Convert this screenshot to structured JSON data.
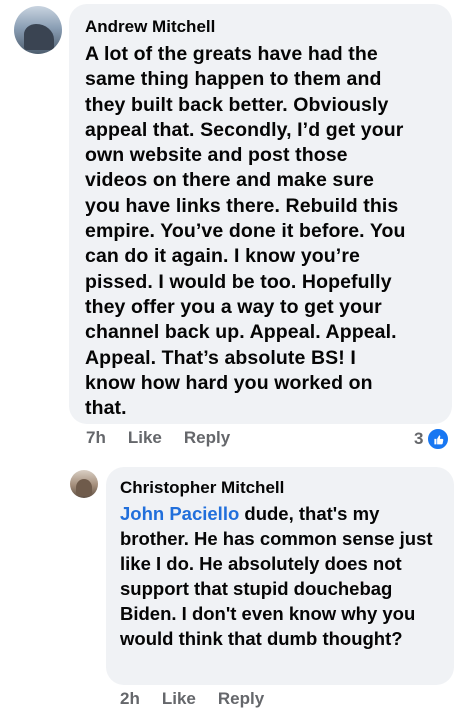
{
  "comments": [
    {
      "author": "Andrew Mitchell",
      "text": "A lot of the greats have had the\nsame thing happen to them and\nthey built back better. Obviously\nappeal that. Secondly, I’d get your\nown website and post those\nvideos on there and make sure\nyou have links there. Rebuild this\nempire. You’ve done it before. You\ncan do it again. I know you’re\npissed. I would be too. Hopefully\nthey offer you a way to get your\nchannel back up. Appeal. Appeal.\nAppeal. That’s absolute BS!  I\nknow how hard you worked on\nthat.",
      "time": "7h",
      "like_label": "Like",
      "reply_label": "Reply",
      "reaction_count": "3",
      "reaction_icon": "thumbs-up-icon",
      "reaction_color": "#1877f2"
    },
    {
      "author": "Christopher Mitchell",
      "mention": "John Paciello",
      "text": " dude, that's my brother. He has common sense just like I do. He absolutely does not support that stupid douchebag Biden. I don't even know why you would think that dumb thought?",
      "time": "2h",
      "like_label": "Like",
      "reply_label": "Reply"
    }
  ],
  "colors": {
    "bubble": "#f0f2f5",
    "mention": "#216fdb",
    "meta": "#65676b",
    "text": "#050505"
  }
}
